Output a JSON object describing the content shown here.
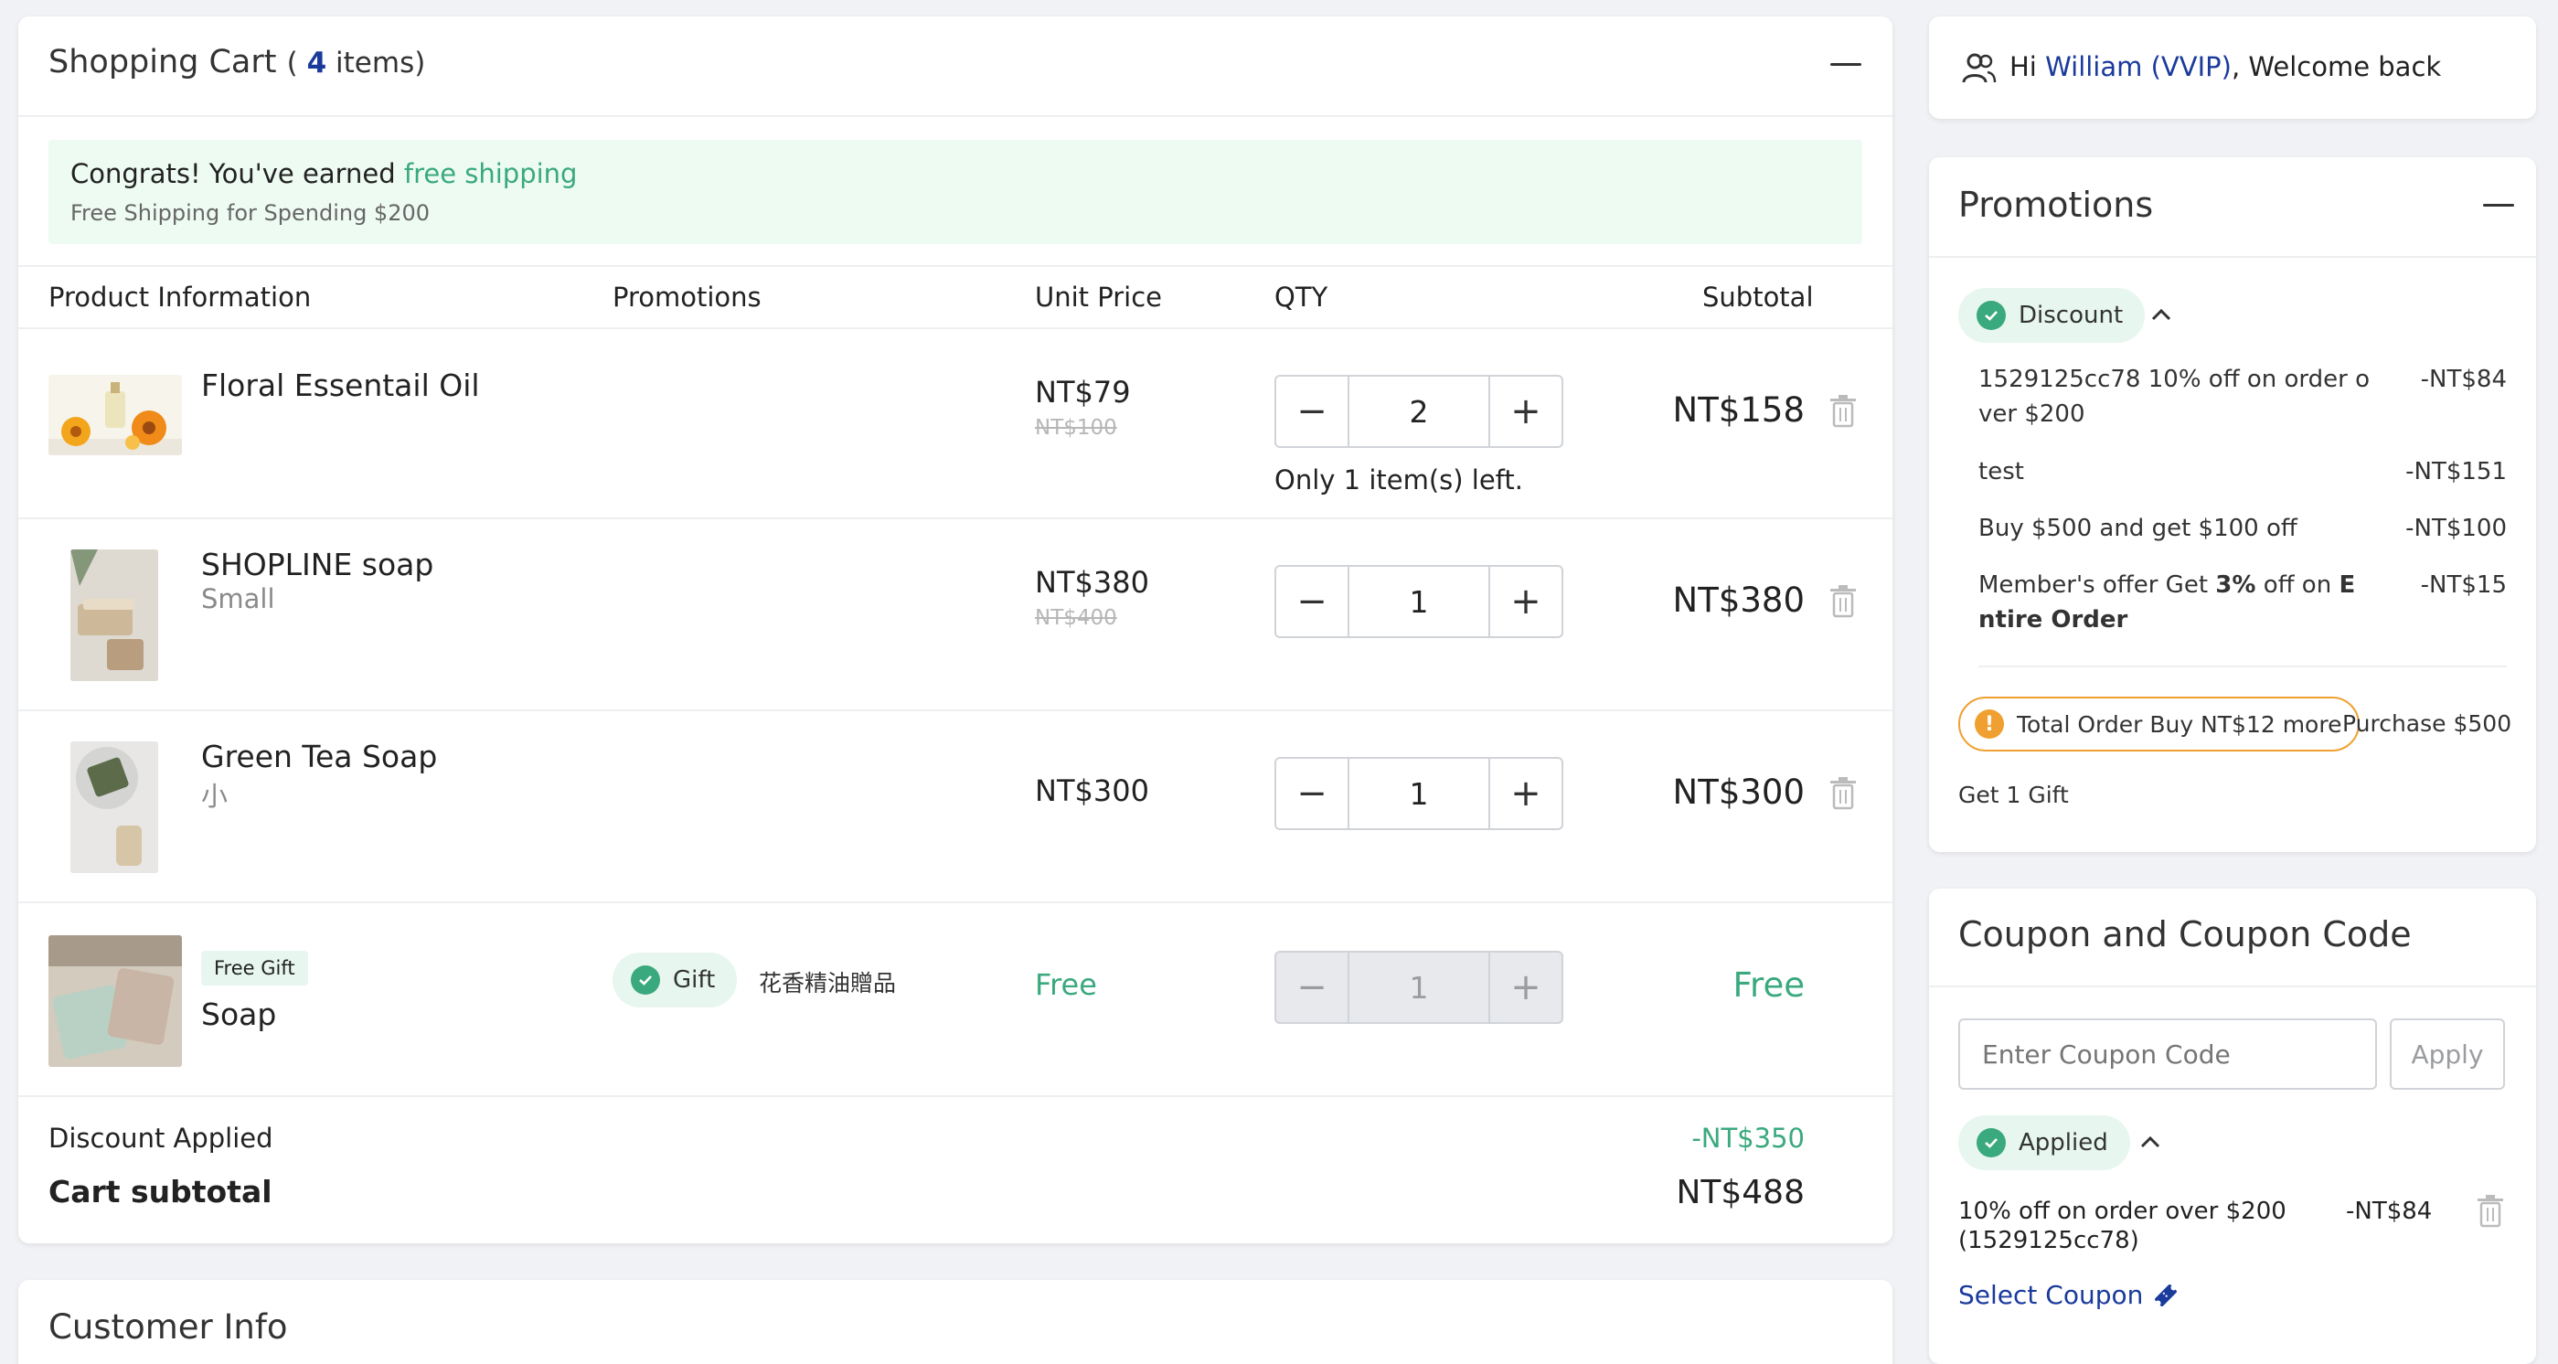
{
  "cart": {
    "title": "Shopping Cart",
    "count_open": "( ",
    "count": "4",
    "count_close": " items)",
    "banner": {
      "prefix": "Congrats! You've earned ",
      "highlight": "free shipping",
      "sub": "Free Shipping for Spending $200"
    },
    "columns": [
      "Product Information",
      "Promotions",
      "Unit Price",
      "QTY",
      "Subtotal"
    ],
    "items": [
      {
        "name": "Floral Essentail Oil",
        "variant": "",
        "price": "NT$79",
        "old_price": "NT$100",
        "qty": "2",
        "note": "Only 1 item(s) left.",
        "subtotal": "NT$158",
        "icon": "oil-bottle-image"
      },
      {
        "name": "SHOPLINE soap",
        "variant": "Small",
        "price": "NT$380",
        "old_price": "NT$400",
        "qty": "1",
        "note": "",
        "subtotal": "NT$380",
        "icon": "soap-image"
      },
      {
        "name": "Green Tea Soap",
        "variant": "小",
        "price": "NT$300",
        "old_price": "",
        "qty": "1",
        "note": "",
        "subtotal": "NT$300",
        "icon": "green-tea-soap-image"
      },
      {
        "name": "Soap",
        "badge": "Free Gift",
        "promo_label": "Gift",
        "promo_text": "花香精油贈品",
        "price": "Free",
        "qty": "1",
        "subtotal": "Free",
        "icon": "gift-soap-image"
      }
    ],
    "discount_label": "Discount Applied",
    "discount_value": "-NT$350",
    "subtotal_label": "Cart subtotal",
    "subtotal_value": "NT$488"
  },
  "customer_info": {
    "title": "Customer Info"
  },
  "welcome": {
    "hi": "Hi ",
    "name": "William (VVIP)",
    "rest": ", Welcome back"
  },
  "promotions": {
    "title": "Promotions",
    "discount_pill": "Discount",
    "lines": [
      {
        "text1": "1529125cc78 10% off on order o",
        "text2": "ver $200",
        "amount": "-NT$84"
      },
      {
        "text1": "test",
        "amount": "-NT$151"
      },
      {
        "text1": "Buy $500 and get $100 off",
        "amount": "-NT$100"
      },
      {
        "text1_pre": "Member's offer Get ",
        "text1_bold": "3%",
        "text1_mid": " off on ",
        "text1_bold2": "E",
        "text2_bold": "ntire Order",
        "amount": "-NT$15"
      }
    ],
    "warning_pill": "Total Order Buy NT$12 more",
    "warning_side": "Purchase $500",
    "warning_sub": "Get 1 Gift"
  },
  "coupon": {
    "title": "Coupon and Coupon Code",
    "placeholder": "Enter Coupon Code",
    "apply": "Apply",
    "applied_pill": "Applied",
    "applied_line1": "10% off on order over $200",
    "applied_line2": "(1529125cc78)",
    "applied_amount": "-NT$84",
    "select": "Select Coupon"
  },
  "colors": {
    "accent_green": "#3aa97e",
    "accent_blue": "#1a3a9c",
    "warning_orange": "#f0a030",
    "banner_bg": "#edfbf3"
  }
}
